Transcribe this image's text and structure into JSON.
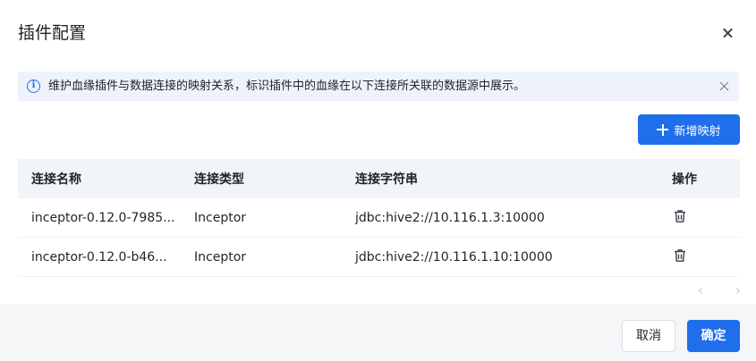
{
  "dialog": {
    "title": "插件配置"
  },
  "alert": {
    "icon": "info-icon",
    "text": "维护血缘插件与数据连接的映射关系，标识插件中的血缘在以下连接所关联的数据源中展示。"
  },
  "toolbar": {
    "add_label": "新增映射"
  },
  "table": {
    "headers": [
      "连接名称",
      "连接类型",
      "连接字符串",
      "操作"
    ],
    "rows": [
      {
        "name": "inceptor-0.12.0-7985...",
        "type": "Inceptor",
        "conn": "jdbc:hive2://10.116.1.3:10000",
        "action_icon": "trash-icon"
      },
      {
        "name": "inceptor-0.12.0-b46...",
        "type": "Inceptor",
        "conn": "jdbc:hive2://10.116.1.10:10000",
        "action_icon": "trash-icon"
      }
    ]
  },
  "pager": {
    "prev": "‹",
    "next": "›"
  },
  "footer": {
    "cancel_label": "取消",
    "ok_label": "确定"
  },
  "colors": {
    "primary": "#1f6eeb",
    "alert_bg": "#eef3fb",
    "header_bg": "#f1f4f8",
    "footer_bg": "#f5f6f8"
  }
}
